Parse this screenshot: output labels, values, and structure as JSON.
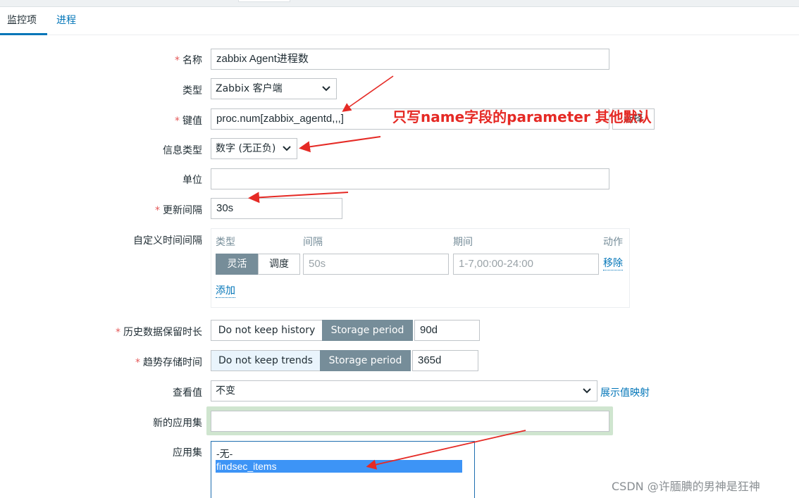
{
  "tabs": [
    {
      "label": "监控项",
      "active": true
    },
    {
      "label": "进程",
      "active": false
    }
  ],
  "form": {
    "name": {
      "label": "名称",
      "required": true,
      "value": "zabbix Agent进程数"
    },
    "type": {
      "label": "类型",
      "value": "Zabbix 客户端"
    },
    "key": {
      "label": "键值",
      "required": true,
      "value": "proc.num[zabbix_agentd,,,]",
      "select_button": "选择"
    },
    "info_type": {
      "label": "信息类型",
      "value": "数字 (无正负)"
    },
    "units": {
      "label": "单位",
      "value": ""
    },
    "update_interval": {
      "label": "更新间隔",
      "required": true,
      "value": "30s"
    },
    "custom_intervals": {
      "label": "自定义时间间隔",
      "headers": {
        "type": "类型",
        "interval": "间隔",
        "period": "期间",
        "action": "动作"
      },
      "row": {
        "flexible": "灵活",
        "scheduling": "调度",
        "interval_placeholder": "50s",
        "period_placeholder": "1-7,00:00-24:00",
        "remove": "移除"
      },
      "add": "添加"
    },
    "history": {
      "label": "历史数据保留时长",
      "required": true,
      "btn_no": "Do not keep history",
      "btn_period": "Storage period",
      "value": "90d"
    },
    "trends": {
      "label": "趋势存储时间",
      "required": true,
      "btn_no": "Do not keep trends",
      "btn_period": "Storage period",
      "value": "365d"
    },
    "show_value": {
      "label": "查看值",
      "value": "不变",
      "link": "展示值映射"
    },
    "new_application": {
      "label": "新的应用集",
      "value": ""
    },
    "applications": {
      "label": "应用集",
      "options": [
        "-无-",
        "findsec_items"
      ],
      "selected": "findsec_items"
    }
  },
  "annotation": "只写name字段的parameter 其他默认",
  "watermark": "CSDN @许腼腆的男神是狂神",
  "colors": {
    "accent": "#0275b8",
    "required": "#e45959",
    "annotation": "#e52a25",
    "segment_on": "#768d99"
  }
}
